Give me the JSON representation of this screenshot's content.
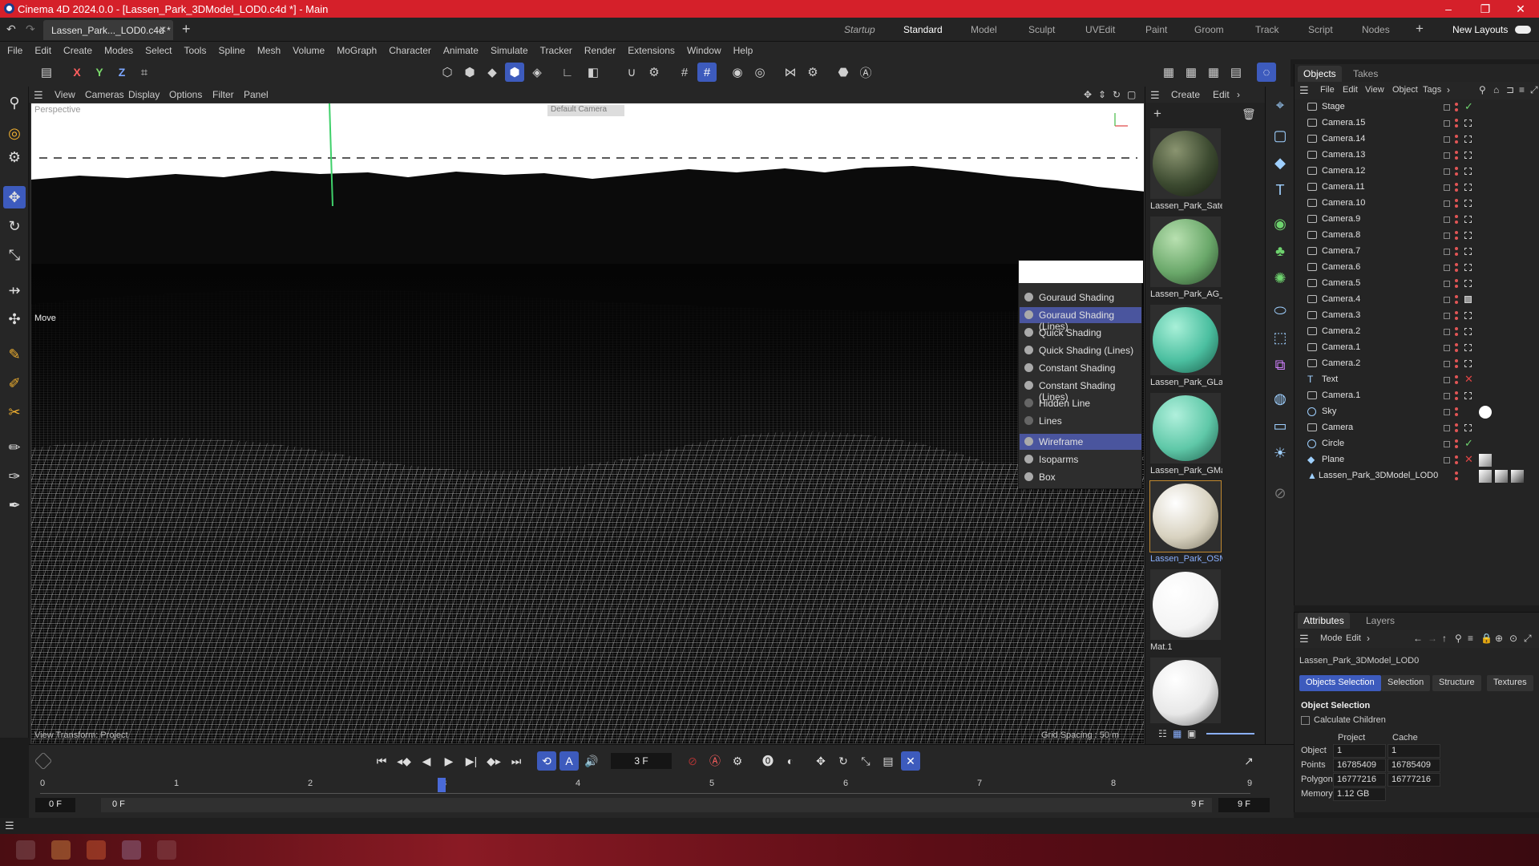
{
  "window": {
    "title": "Cinema 4D 2024.0.0 - [Lassen_Park_3DModel_LOD0.c4d *] - Main"
  },
  "doc_tab": {
    "label": "Lassen_Park..._LOD0.c4d *"
  },
  "layouts": [
    "Startup",
    "Standard",
    "Model",
    "Sculpt",
    "UVEdit",
    "Paint",
    "Groom",
    "Track",
    "Script",
    "Nodes"
  ],
  "new_layouts": "New Layouts",
  "menu": [
    "File",
    "Edit",
    "Create",
    "Modes",
    "Select",
    "Tools",
    "Spline",
    "Mesh",
    "Volume",
    "MoGraph",
    "Character",
    "Animate",
    "Simulate",
    "Tracker",
    "Render",
    "Extensions",
    "Window",
    "Help"
  ],
  "axis": {
    "x": "X",
    "y": "Y",
    "z": "Z"
  },
  "viewport": {
    "menu": [
      "View",
      "Cameras",
      "Display",
      "Options",
      "Filter",
      "Panel"
    ],
    "camera_label": "Perspective",
    "camera_button": "Default Camera",
    "move_label": "Move",
    "footer_left": "View Transform: Project",
    "footer_right": "Grid Spacing : 50 m"
  },
  "shading_menu": [
    {
      "label": "Gouraud Shading",
      "selected": false
    },
    {
      "label": "Gouraud Shading (Lines)",
      "selected": true
    },
    {
      "label": "Quick Shading",
      "selected": false
    },
    {
      "label": "Quick Shading (Lines)",
      "selected": false
    },
    {
      "label": "Constant Shading",
      "selected": false
    },
    {
      "label": "Constant Shading (Lines)",
      "selected": false
    },
    {
      "label": "Hidden Line",
      "selected": false
    },
    {
      "label": "Lines",
      "selected": false
    },
    {
      "label": "Wireframe",
      "selected": true
    },
    {
      "label": "Isoparms",
      "selected": false
    },
    {
      "label": "Box",
      "selected": false
    }
  ],
  "materials": {
    "menu": [
      "Create",
      "Edit"
    ],
    "items": [
      {
        "label": "Lassen_Park_Satel",
        "color": "#3c4a30"
      },
      {
        "label": "Lassen_Park_AG_L",
        "color": "#6aa86a"
      },
      {
        "label": "Lassen_Park_GLan",
        "color": "#4bbfa0"
      },
      {
        "label": "Lassen_Park_GMa",
        "color": "#5fc8a8"
      },
      {
        "label": "Lassen_Park_OSM",
        "color": "#d8d2c0"
      },
      {
        "label": "Mat.1",
        "color": "#ffffff"
      },
      {
        "label": "",
        "color": "#e8e8e8"
      }
    ]
  },
  "objects_panel": {
    "tabs": [
      "Objects",
      "Takes"
    ],
    "menu": [
      "File",
      "Edit",
      "View",
      "Object",
      "Tags"
    ],
    "items": [
      "Stage",
      "Camera.15",
      "Camera.14",
      "Camera.13",
      "Camera.12",
      "Camera.11",
      "Camera.10",
      "Camera.9",
      "Camera.8",
      "Camera.7",
      "Camera.6",
      "Camera.5",
      "Camera.4",
      "Camera.3",
      "Camera.2",
      "Camera.1",
      "Camera.2",
      "Text",
      "Camera.1",
      "Sky",
      "Camera",
      "Circle",
      "Plane",
      "Lassen_Park_3DModel_LOD0"
    ]
  },
  "attributes": {
    "tabs": [
      "Attributes",
      "Layers"
    ],
    "menu": [
      "Mode",
      "Edit"
    ],
    "object_name": "Lassen_Park_3DModel_LOD0",
    "subtabs": [
      "Objects Selection",
      "Selection",
      "Structure",
      "Textures"
    ],
    "section": "Object Selection",
    "calc_children": "Calculate Children",
    "col_project": "Project",
    "col_cache": "Cache",
    "rows": [
      {
        "label": "Object",
        "project": "1",
        "cache": "1"
      },
      {
        "label": "Points",
        "project": "16785409",
        "cache": "16785409"
      },
      {
        "label": "Polygons",
        "project": "16777216",
        "cache": "16777216"
      },
      {
        "label": "Memory",
        "project": "1.12 GB",
        "cache": ""
      }
    ]
  },
  "timeline": {
    "current_frame": "3 F",
    "ticks": [
      "0",
      "1",
      "2",
      "3",
      "4",
      "5",
      "6",
      "7",
      "8",
      "9"
    ],
    "start_a": "0 F",
    "start_b": "0 F",
    "end_a": "9 F",
    "end_b": "9 F",
    "playhead_frame": 3
  }
}
